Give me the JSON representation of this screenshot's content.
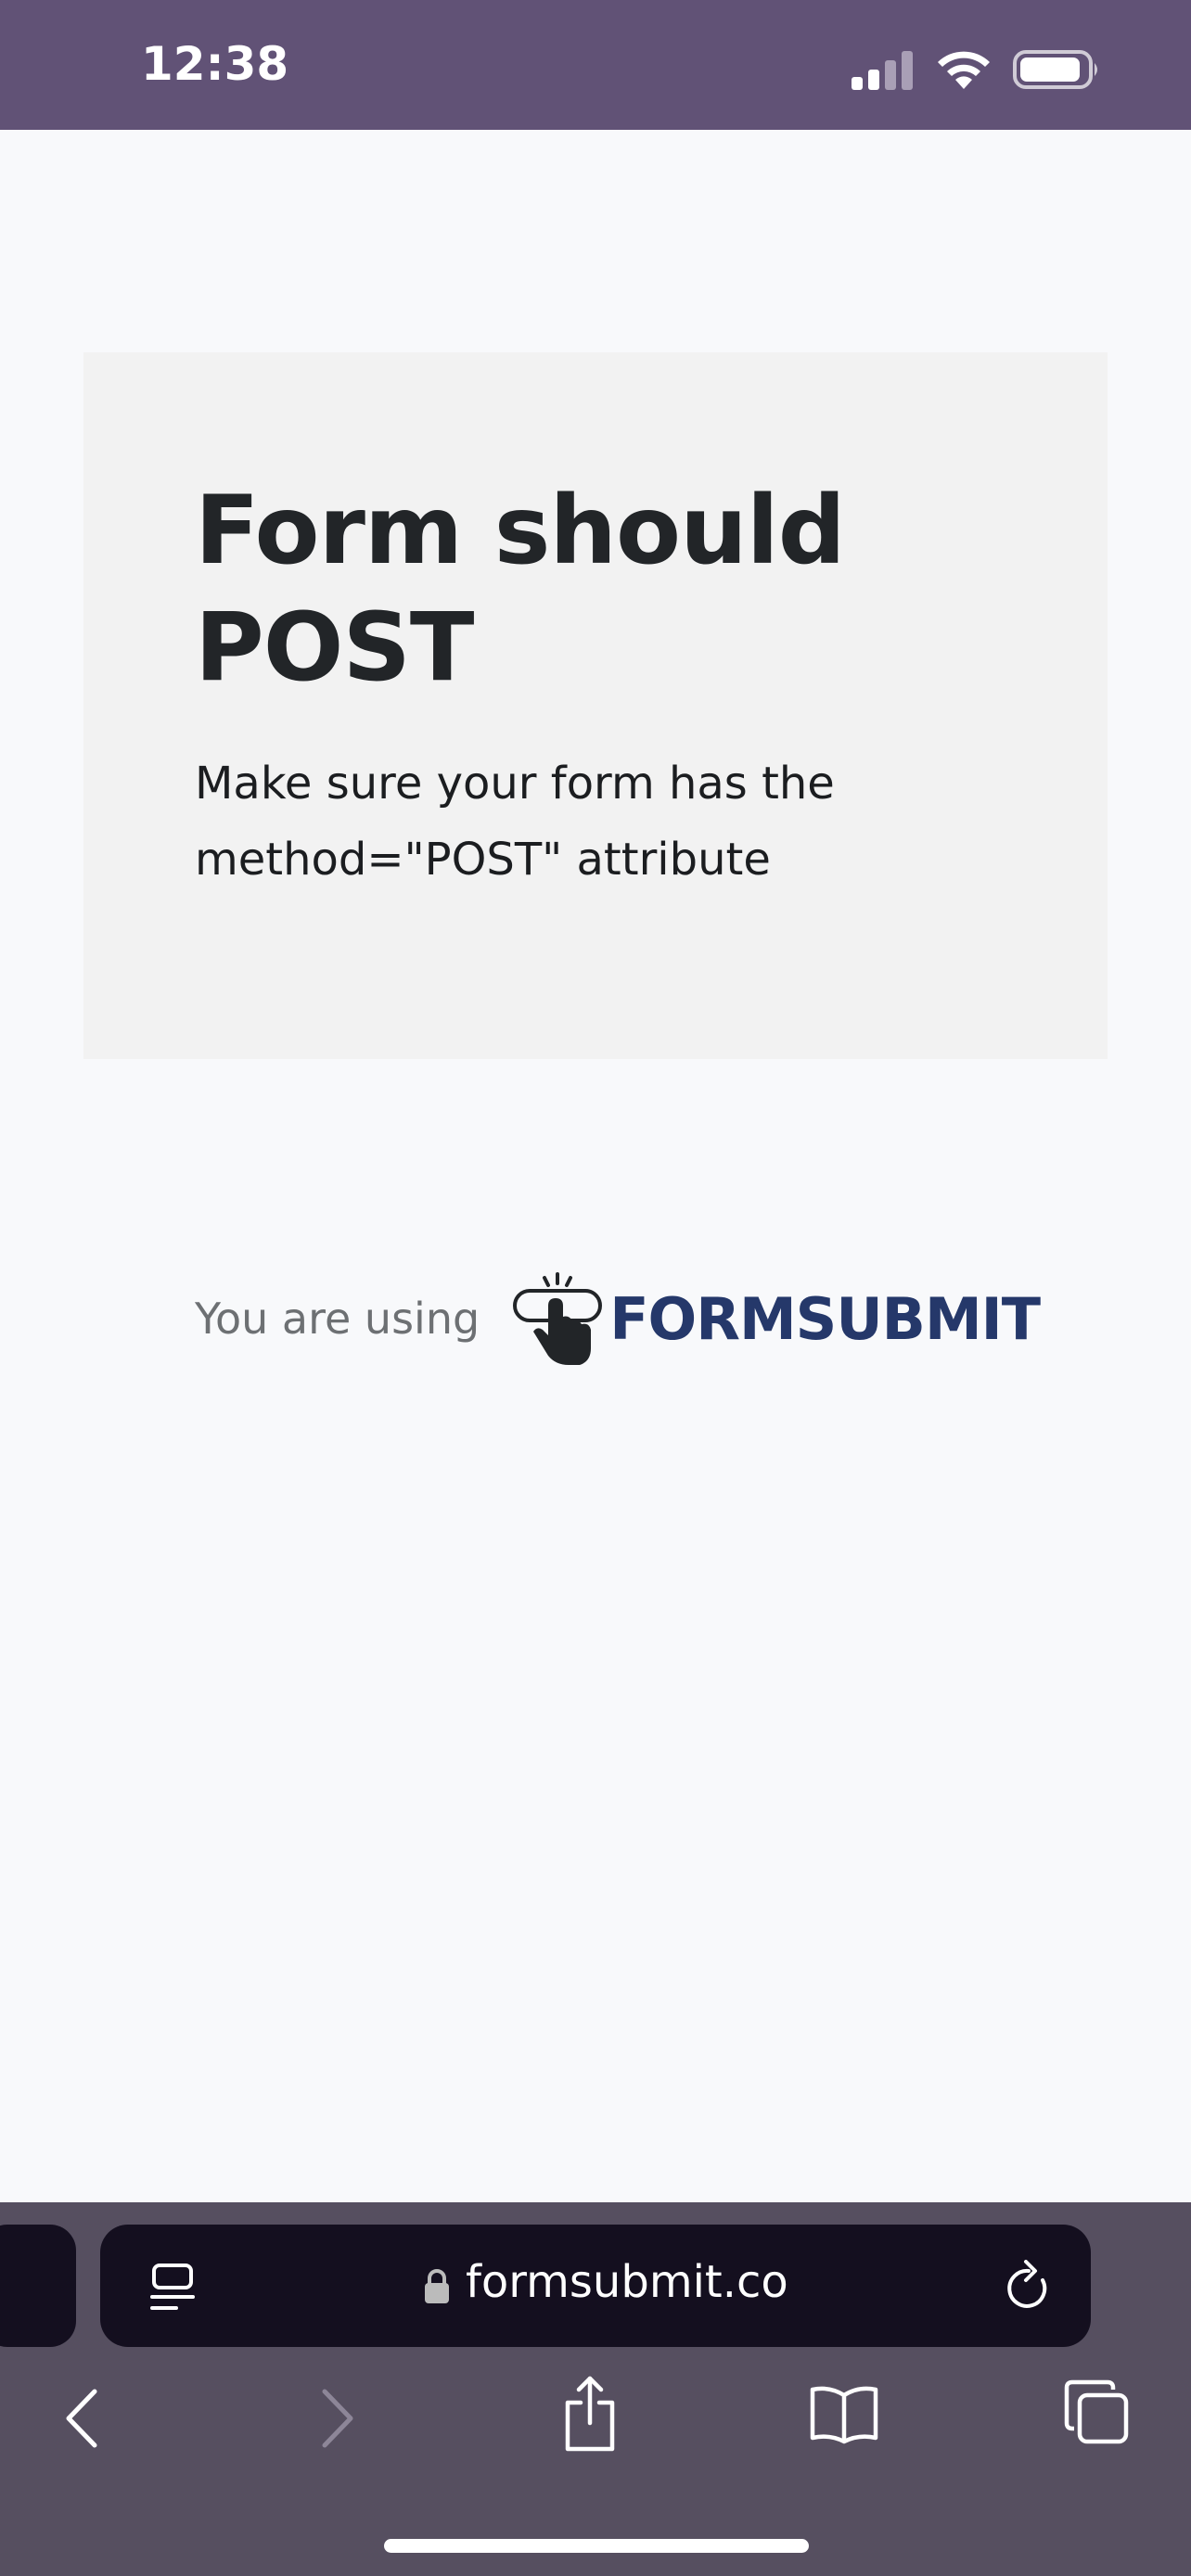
{
  "status_bar": {
    "time": "12:38"
  },
  "error_card": {
    "title": "Form should POST",
    "message": "Make sure your form has the method=\"POST\" attribute"
  },
  "footer": {
    "using_label": "You are using",
    "brand_name": "FORMSUBMIT"
  },
  "browser": {
    "url": "formsubmit.co"
  },
  "colors": {
    "status_bar_bg": "#615276",
    "brand": "#25386a",
    "toolbar_bg": "#564f60"
  }
}
